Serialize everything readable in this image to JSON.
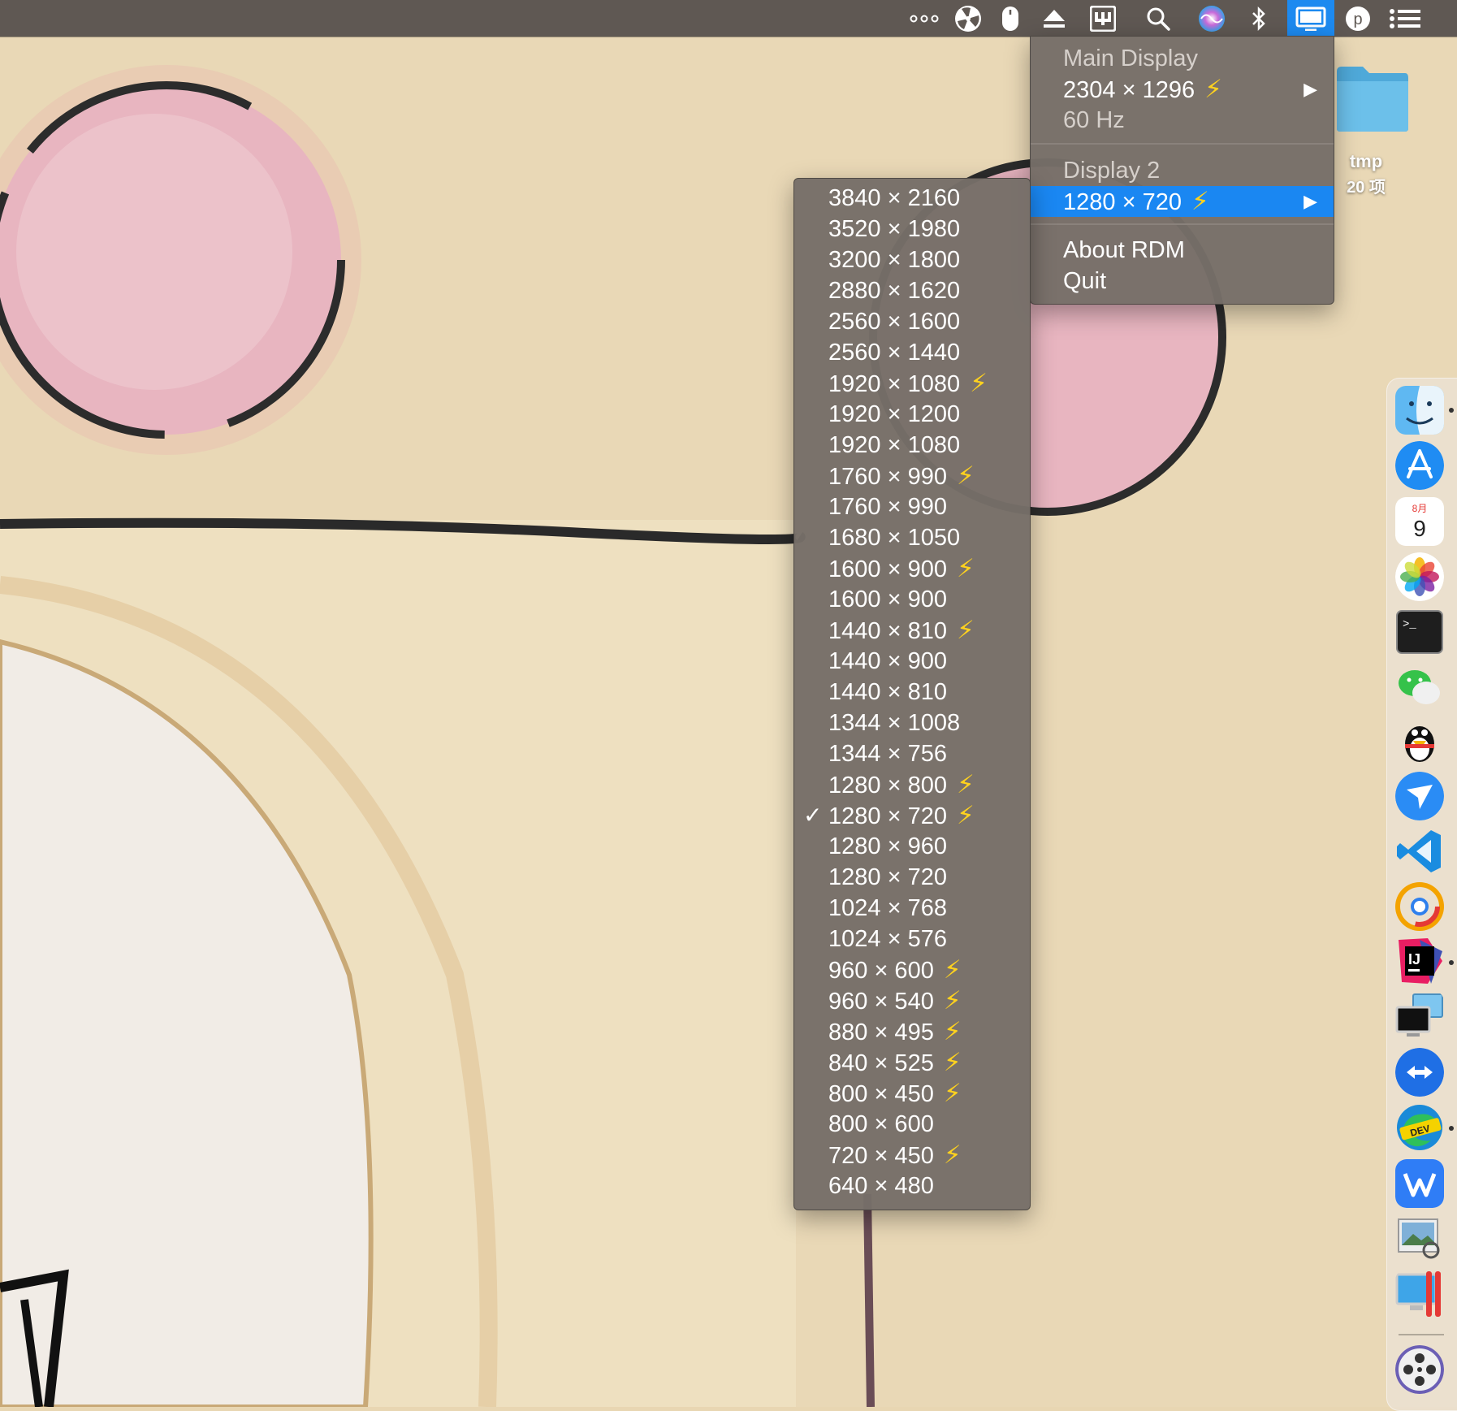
{
  "menubar": {
    "status_icons": [
      "more-dots-icon",
      "fan-control-icon",
      "mouse-icon",
      "eject-icon",
      "clipboard-app-icon",
      "spotlight-search-icon",
      "siri-icon",
      "bluetooth-icon",
      "display-rdm-icon",
      "p-app-icon",
      "notification-center-icon"
    ],
    "active_icon": "display-rdm-icon",
    "p_letter": "p"
  },
  "main_menu": {
    "main_display_header": "Main Display",
    "main_display_resolution": "2304 × 1296",
    "main_display_refresh": "60 Hz",
    "display2_header": "Display 2",
    "display2_resolution": "1280 × 720",
    "about": "About RDM",
    "quit": "Quit",
    "arrow": "▶",
    "bolt": "⚡"
  },
  "resolutions_menu": {
    "check_glyph": "✓",
    "items": [
      {
        "label": "3840 × 2160",
        "hidpi": false,
        "checked": false
      },
      {
        "label": "3520 × 1980",
        "hidpi": false,
        "checked": false
      },
      {
        "label": "3200 × 1800",
        "hidpi": false,
        "checked": false
      },
      {
        "label": "2880 × 1620",
        "hidpi": false,
        "checked": false
      },
      {
        "label": "2560 × 1600",
        "hidpi": false,
        "checked": false
      },
      {
        "label": "2560 × 1440",
        "hidpi": false,
        "checked": false
      },
      {
        "label": "1920 × 1080",
        "hidpi": true,
        "checked": false
      },
      {
        "label": "1920 × 1200",
        "hidpi": false,
        "checked": false
      },
      {
        "label": "1920 × 1080",
        "hidpi": false,
        "checked": false
      },
      {
        "label": "1760 × 990",
        "hidpi": true,
        "checked": false
      },
      {
        "label": "1760 × 990",
        "hidpi": false,
        "checked": false
      },
      {
        "label": "1680 × 1050",
        "hidpi": false,
        "checked": false
      },
      {
        "label": "1600 × 900",
        "hidpi": true,
        "checked": false
      },
      {
        "label": "1600 × 900",
        "hidpi": false,
        "checked": false
      },
      {
        "label": "1440 × 810",
        "hidpi": true,
        "checked": false
      },
      {
        "label": "1440 × 900",
        "hidpi": false,
        "checked": false
      },
      {
        "label": "1440 × 810",
        "hidpi": false,
        "checked": false
      },
      {
        "label": "1344 × 1008",
        "hidpi": false,
        "checked": false
      },
      {
        "label": "1344 × 756",
        "hidpi": false,
        "checked": false
      },
      {
        "label": "1280 × 800",
        "hidpi": true,
        "checked": false
      },
      {
        "label": "1280 × 720",
        "hidpi": true,
        "checked": true
      },
      {
        "label": "1280 × 960",
        "hidpi": false,
        "checked": false
      },
      {
        "label": "1280 × 720",
        "hidpi": false,
        "checked": false
      },
      {
        "label": "1024 × 768",
        "hidpi": false,
        "checked": false
      },
      {
        "label": "1024 × 576",
        "hidpi": false,
        "checked": false
      },
      {
        "label": "960 × 600",
        "hidpi": true,
        "checked": false
      },
      {
        "label": "960 × 540",
        "hidpi": true,
        "checked": false
      },
      {
        "label": "880 × 495",
        "hidpi": true,
        "checked": false
      },
      {
        "label": "840 × 525",
        "hidpi": true,
        "checked": false
      },
      {
        "label": "800 × 450",
        "hidpi": true,
        "checked": false
      },
      {
        "label": "800 × 600",
        "hidpi": false,
        "checked": false
      },
      {
        "label": "720 × 450",
        "hidpi": true,
        "checked": false
      },
      {
        "label": "640 × 480",
        "hidpi": false,
        "checked": false
      }
    ]
  },
  "desktop": {
    "folder_name": "tmp",
    "folder_count": "20 项"
  },
  "dock": {
    "apps": [
      "finder",
      "app-store",
      "calendar",
      "photos",
      "terminal",
      "wechat",
      "qq",
      "feishu",
      "vscode",
      "chrome-canary",
      "intellij-idea",
      "screen-sharing",
      "teamviewer",
      "edge-dev",
      "wps-office",
      "preview",
      "parallels-desktop",
      "video-player"
    ],
    "running": [
      "finder",
      "intellij-idea",
      "edge-dev"
    ],
    "calendar_month": "8月",
    "calendar_day": "9",
    "terminal_prompt": ">_",
    "ij_label": "IJ",
    "dev_label": "DEV"
  },
  "colors": {
    "menubar": "#5f5853",
    "menu_bg": "#766e68",
    "highlight": "#1a87f2",
    "bolt": "#ffd21e",
    "wallpaper": "#e8d6b2"
  }
}
